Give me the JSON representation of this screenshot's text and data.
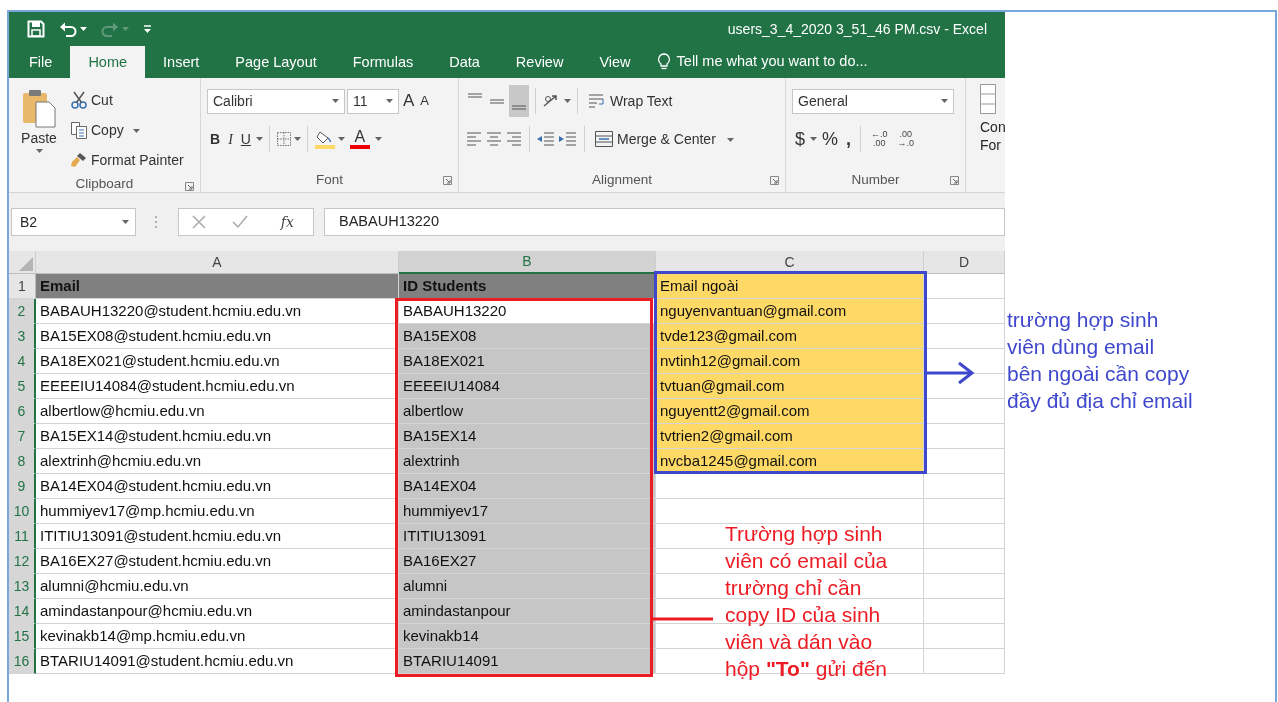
{
  "window": {
    "title": "users_3_4_2020 3_51_46 PM.csv - Excel"
  },
  "quick_access": [
    {
      "kind": "save",
      "disabled": false
    },
    {
      "kind": "undo",
      "disabled": false
    },
    {
      "kind": "redo",
      "disabled": true
    },
    {
      "kind": "customize",
      "disabled": false
    }
  ],
  "tabs": [
    {
      "label": "File",
      "selected": false
    },
    {
      "label": "Home",
      "selected": true
    },
    {
      "label": "Insert",
      "selected": false
    },
    {
      "label": "Page Layout",
      "selected": false
    },
    {
      "label": "Formulas",
      "selected": false
    },
    {
      "label": "Data",
      "selected": false
    },
    {
      "label": "Review",
      "selected": false
    },
    {
      "label": "View",
      "selected": false
    }
  ],
  "tell_me": "Tell me what you want to do...",
  "ribbon": {
    "clipboard": {
      "label": "Clipboard",
      "paste": "Paste",
      "cut": "Cut",
      "copy": "Copy",
      "format_painter": "Format Painter"
    },
    "font": {
      "label": "Font",
      "font_name": "Calibri",
      "font_size": "11",
      "grow": "A",
      "shrink": "A",
      "bold": "B",
      "italic": "I",
      "underline": "U",
      "font_color": "A"
    },
    "alignment": {
      "label": "Alignment",
      "vertical_align": [
        {
          "selected": false
        },
        {
          "selected": false
        },
        {
          "selected": true
        }
      ],
      "wrap_text": "Wrap Text",
      "merge": "Merge & Center"
    },
    "number": {
      "label": "Number",
      "format": "General",
      "currency": "$",
      "percent": "%",
      "comma": ",",
      "decimals": [
        {
          "top": "←.0",
          "bottom": ".00"
        },
        {
          "top": ".00",
          "bottom": "→.0"
        }
      ]
    },
    "styles": {
      "lines": [
        "Con",
        "For"
      ]
    }
  },
  "formula_bar": {
    "name_box": "B2",
    "fx": "fx",
    "value": "BABAUH13220"
  },
  "columns": [
    {
      "label": "A",
      "selected": false
    },
    {
      "label": "B",
      "selected": true
    },
    {
      "label": "C",
      "selected": false
    },
    {
      "label": "D",
      "selected": false
    }
  ],
  "rows": [
    {
      "number": "1",
      "selected": false,
      "cells": [
        {
          "kind": "header",
          "text": "Email"
        },
        {
          "kind": "header",
          "text": "ID Students"
        },
        {
          "kind": "highlight",
          "text": "Email ngoài"
        },
        {
          "kind": "plain"
        }
      ]
    },
    {
      "number": "2",
      "selected": true,
      "cells": [
        {
          "kind": "plain",
          "text": "BABAUH13220@student.hcmiu.edu.vn"
        },
        {
          "kind": "active",
          "text": "BABAUH13220"
        },
        {
          "kind": "highlight",
          "text": "nguyenvantuan@gmail.com"
        },
        {
          "kind": "plain"
        }
      ]
    },
    {
      "number": "3",
      "selected": true,
      "cells": [
        {
          "kind": "plain",
          "text": "BA15EX08@student.hcmiu.edu.vn"
        },
        {
          "kind": "selected",
          "text": "BA15EX08"
        },
        {
          "kind": "highlight",
          "text": "tvde123@gmail.com"
        },
        {
          "kind": "plain"
        }
      ]
    },
    {
      "number": "4",
      "selected": true,
      "cells": [
        {
          "kind": "plain",
          "text": "BA18EX021@student.hcmiu.edu.vn"
        },
        {
          "kind": "selected",
          "text": "BA18EX021"
        },
        {
          "kind": "highlight",
          "text": "nvtinh12@gmail.com"
        },
        {
          "kind": "plain"
        }
      ]
    },
    {
      "number": "5",
      "selected": true,
      "cells": [
        {
          "kind": "plain",
          "text": "EEEEIU14084@student.hcmiu.edu.vn"
        },
        {
          "kind": "selected",
          "text": "EEEEIU14084"
        },
        {
          "kind": "highlight",
          "text": "tvtuan@gmail.com"
        },
        {
          "kind": "plain"
        }
      ]
    },
    {
      "number": "6",
      "selected": true,
      "cells": [
        {
          "kind": "plain",
          "text": "albertlow@hcmiu.edu.vn"
        },
        {
          "kind": "selected",
          "text": "albertlow"
        },
        {
          "kind": "highlight",
          "text": "nguyentt2@gmail.com"
        },
        {
          "kind": "plain"
        }
      ]
    },
    {
      "number": "7",
      "selected": true,
      "cells": [
        {
          "kind": "plain",
          "text": "BA15EX14@student.hcmiu.edu.vn"
        },
        {
          "kind": "selected",
          "text": "BA15EX14"
        },
        {
          "kind": "highlight",
          "text": "tvtrien2@gmail.com"
        },
        {
          "kind": "plain"
        }
      ]
    },
    {
      "number": "8",
      "selected": true,
      "cells": [
        {
          "kind": "plain",
          "text": "alextrinh@hcmiu.edu.vn"
        },
        {
          "kind": "selected",
          "text": "alextrinh"
        },
        {
          "kind": "highlight",
          "text": "nvcba1245@gmail.com"
        },
        {
          "kind": "plain"
        }
      ]
    },
    {
      "number": "9",
      "selected": true,
      "cells": [
        {
          "kind": "plain",
          "text": "BA14EX04@student.hcmiu.edu.vn"
        },
        {
          "kind": "selected",
          "text": "BA14EX04"
        },
        {
          "kind": "plain"
        },
        {
          "kind": "plain"
        }
      ]
    },
    {
      "number": "10",
      "selected": true,
      "cells": [
        {
          "kind": "plain",
          "text": "hummiyev17@mp.hcmiu.edu.vn"
        },
        {
          "kind": "selected",
          "text": "hummiyev17"
        },
        {
          "kind": "plain"
        },
        {
          "kind": "plain"
        }
      ]
    },
    {
      "number": "11",
      "selected": true,
      "cells": [
        {
          "kind": "plain",
          "text": "ITITIU13091@student.hcmiu.edu.vn"
        },
        {
          "kind": "selected",
          "text": "ITITIU13091"
        },
        {
          "kind": "plain"
        },
        {
          "kind": "plain"
        }
      ]
    },
    {
      "number": "12",
      "selected": true,
      "cells": [
        {
          "kind": "plain",
          "text": "BA16EX27@student.hcmiu.edu.vn"
        },
        {
          "kind": "selected",
          "text": "BA16EX27"
        },
        {
          "kind": "plain"
        },
        {
          "kind": "plain"
        }
      ]
    },
    {
      "number": "13",
      "selected": true,
      "cells": [
        {
          "kind": "plain",
          "text": "alumni@hcmiu.edu.vn"
        },
        {
          "kind": "selected",
          "text": "alumni"
        },
        {
          "kind": "plain"
        },
        {
          "kind": "plain"
        }
      ]
    },
    {
      "number": "14",
      "selected": true,
      "cells": [
        {
          "kind": "plain",
          "text": "amindastanpour@hcmiu.edu.vn"
        },
        {
          "kind": "selected",
          "text": "amindastanpour"
        },
        {
          "kind": "plain"
        },
        {
          "kind": "plain"
        }
      ]
    },
    {
      "number": "15",
      "selected": true,
      "cells": [
        {
          "kind": "plain",
          "text": "kevinakb14@mp.hcmiu.edu.vn"
        },
        {
          "kind": "selected",
          "text": "kevinakb14"
        },
        {
          "kind": "plain"
        },
        {
          "kind": "plain"
        }
      ]
    },
    {
      "number": "16",
      "selected": true,
      "cells": [
        {
          "kind": "plain",
          "text": "BTARIU14091@student.hcmiu.edu.vn"
        },
        {
          "kind": "selected",
          "text": "BTARIU14091"
        },
        {
          "kind": "plain"
        },
        {
          "kind": "plain"
        }
      ]
    }
  ],
  "notes": [
    {
      "kind": "external",
      "color": "#3f48cc",
      "lines": [
        "trường hợp sinh",
        "viên dùng email",
        "bên ngoài cần copy",
        "đầy đủ địa chỉ email"
      ]
    },
    {
      "kind": "internal",
      "color": "#ed1c24",
      "lines": [
        "Trường hợp sinh",
        "viên có email của",
        "trường chỉ cần",
        "copy ID của sinh",
        "viên và dán vào",
        "hộp **\"To\"** gửi đến"
      ]
    }
  ]
}
